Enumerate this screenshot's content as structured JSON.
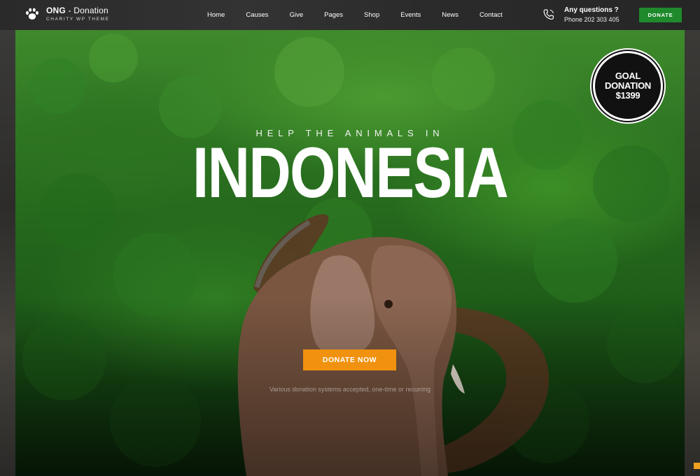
{
  "header": {
    "brand": "ONG",
    "brand_suffix": "- Donation",
    "tagline": "CHARITY WP THEME",
    "nav": [
      "Home",
      "Causes",
      "Give",
      "Pages",
      "Shop",
      "Events",
      "News",
      "Contact"
    ],
    "contact_question": "Any questions ?",
    "contact_phone": "Phone 202 303 405",
    "donate_label": "DONATE"
  },
  "hero": {
    "eyebrow": "HELP THE ANIMALS IN",
    "headline": "INDONESIA",
    "badge_line1": "GOAL",
    "badge_line2": "DONATION",
    "badge_line3": "$1399",
    "cta_label": "DONATE NOW",
    "cta_note": "Various donation systems accepted, one-time or recurring"
  },
  "colors": {
    "accent_green": "#1e8a2c",
    "accent_orange": "#f0920f",
    "header_bg": "#2e2e2e"
  },
  "icons": {
    "logo": "paw-icon",
    "phone": "phone-icon"
  }
}
